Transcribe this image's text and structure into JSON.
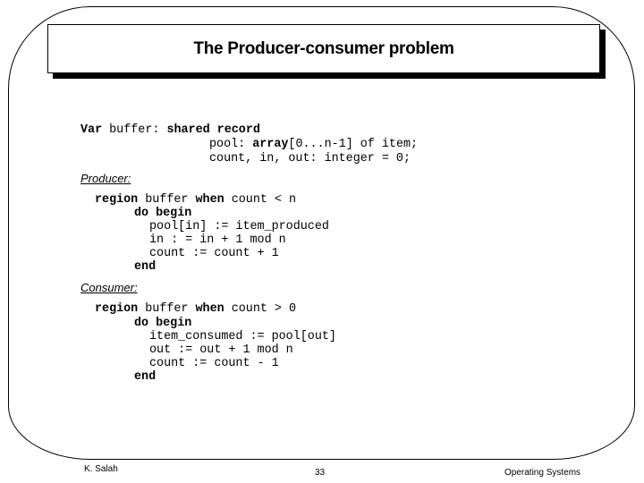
{
  "slide": {
    "title": "The Producer-consumer problem",
    "declaration": [
      {
        "kw1": "Var",
        "text1": " buffer: ",
        "kw2": "shared record",
        "text2": ""
      },
      {
        "indent": "                ",
        "text1": "pool: ",
        "kw": "array",
        "text2": "[0...n-1] of item;"
      },
      {
        "indent": "                ",
        "text": "count, in, out: integer = 0;"
      }
    ],
    "producer": {
      "label": "Producer:",
      "lines": {
        "l1_kw1": "region",
        "l1_t1": " buffer ",
        "l1_kw2": "when",
        "l1_t2": " count < n",
        "l2": "do begin",
        "l3": "pool[in] := item_produced",
        "l4": "in : = in + 1 mod n",
        "l5": "count := count + 1",
        "l6": "end"
      }
    },
    "consumer": {
      "label": "Consumer:",
      "lines": {
        "l1_kw1": "region",
        "l1_t1": " buffer ",
        "l1_kw2": "when",
        "l1_t2": " count > 0",
        "l2": "do begin",
        "l3": "item_consumed := pool[out]",
        "l4": "out := out + 1 mod n",
        "l5": "count := count - 1",
        "l6": "end"
      }
    }
  },
  "footer": {
    "author": "K. Salah",
    "page_number": "33",
    "course": "Operating Systems"
  }
}
